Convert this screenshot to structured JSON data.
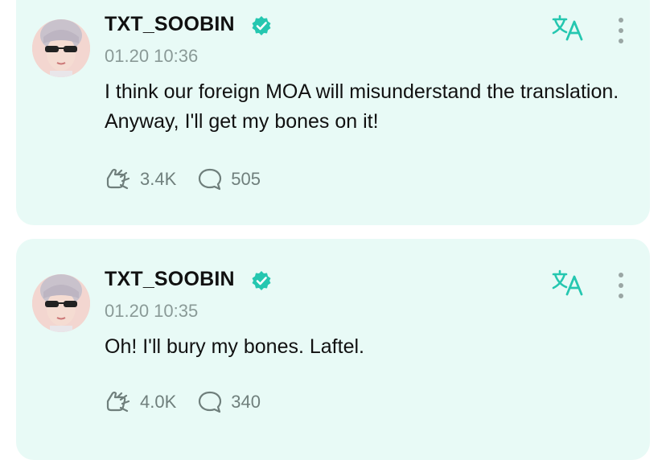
{
  "posts": [
    {
      "author": "TXT_SOOBIN",
      "time": "01.20 10:36",
      "text": "I think our foreign MOA will misunderstand the translation. Anyway, I'll get my bones on it!",
      "likes": "3.4K",
      "comments": "505"
    },
    {
      "author": "TXT_SOOBIN",
      "time": "01.20 10:35",
      "text": "Oh! I'll bury my bones. Laftel.",
      "likes": "4.0K",
      "comments": "340"
    }
  ],
  "colors": {
    "card_bg": "#e8faf6",
    "accent": "#25c7b0",
    "text": "#111111",
    "muted": "#8a9a97"
  },
  "icons": [
    "verified-badge-icon",
    "translate-icon",
    "more-vertical-icon",
    "like-icon",
    "comment-icon"
  ]
}
